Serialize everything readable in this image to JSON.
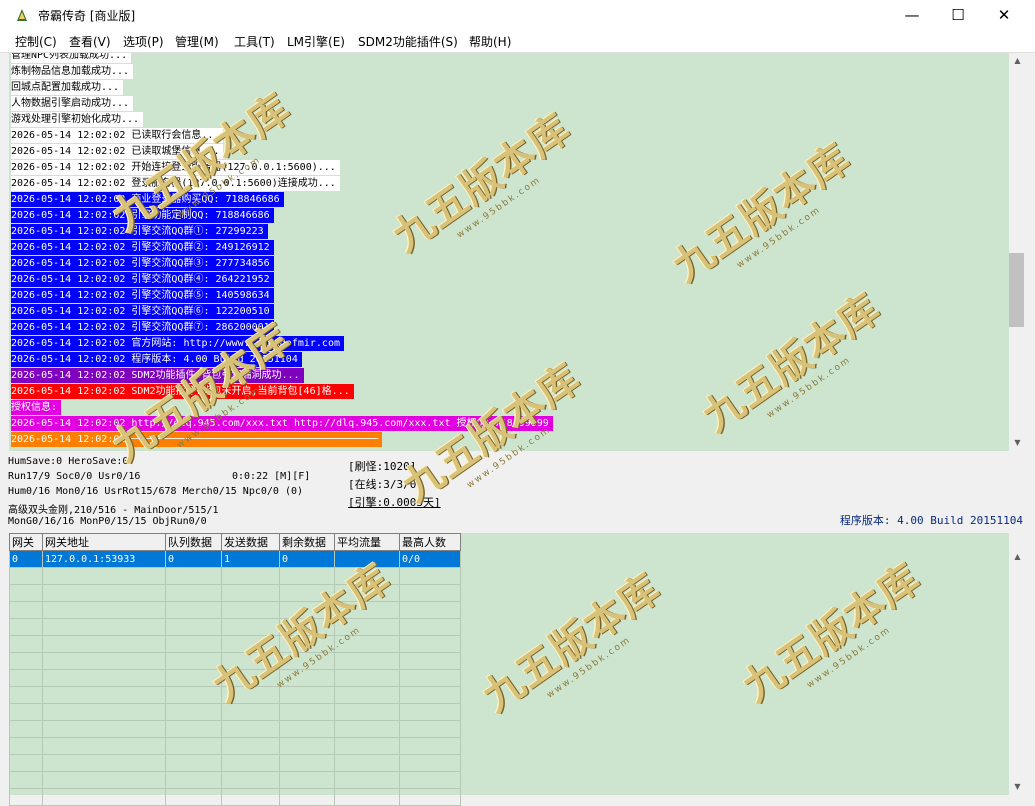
{
  "window": {
    "title": "帝霸传奇 [商业版]",
    "minimize": "—",
    "maximize": "☐",
    "close": "✕"
  },
  "menu": [
    "控制(C)",
    "查看(V)",
    "选项(P)",
    "管理(M)",
    "工具(T)",
    "LM引擎(E)",
    "SDM2功能插件(S)",
    "帮助(H)"
  ],
  "colors": {
    "log_bg": "#cde5cf",
    "blue": "#0000ff",
    "purple": "#8000c0",
    "red": "#ff0000",
    "magenta": "#e000e0",
    "orange": "#ff8000"
  },
  "log": [
    {
      "text": "管理NPC列表加载成功...",
      "bg": "#ffffff",
      "fg": "#000000"
    },
    {
      "text": "炼制物品信息加载成功...",
      "bg": "#ffffff",
      "fg": "#000000"
    },
    {
      "text": "回城点配置加载成功...",
      "bg": "#ffffff",
      "fg": "#000000"
    },
    {
      "text": "人物数据引擎启动成功...",
      "bg": "#ffffff",
      "fg": "#000000"
    },
    {
      "text": "游戏处理引擎初始化成功...",
      "bg": "#ffffff",
      "fg": "#000000"
    },
    {
      "text": "2026-05-14 12:02:02 已读取行会信息...",
      "bg": "#ffffff",
      "fg": "#000000"
    },
    {
      "text": "2026-05-14 12:02:02 已读取城堡信息...",
      "bg": "#ffffff",
      "fg": "#000000"
    },
    {
      "text": "2026-05-14 12:02:02 开始连接登录服务器(127.0.0.1:5600)...",
      "bg": "#ffffff",
      "fg": "#000000"
    },
    {
      "text": "2026-05-14 12:02:02 登录服务器(127.0.0.1:5600)连接成功...",
      "bg": "#ffffff",
      "fg": "#000000"
    },
    {
      "text": "2026-05-14 12:02:02 商业登录器购买QQ: 718846686",
      "bg": "#0000ff",
      "fg": "#ffffff"
    },
    {
      "text": "2026-05-14 12:02:02 引擎功能定制QQ: 718846686",
      "bg": "#0000ff",
      "fg": "#ffffff"
    },
    {
      "text": "2026-05-14 12:02:02 引擎交流QQ群①: 27299223",
      "bg": "#0000ff",
      "fg": "#ffffff"
    },
    {
      "text": "2026-05-14 12:02:02 引擎交流QQ群②: 249126912",
      "bg": "#0000ff",
      "fg": "#ffffff"
    },
    {
      "text": "2026-05-14 12:02:02 引擎交流QQ群③: 277734856",
      "bg": "#0000ff",
      "fg": "#ffffff"
    },
    {
      "text": "2026-05-14 12:02:02 引擎交流QQ群④: 264221952",
      "bg": "#0000ff",
      "fg": "#ffffff"
    },
    {
      "text": "2026-05-14 12:02:02 引擎交流QQ群⑤: 140598634",
      "bg": "#0000ff",
      "fg": "#ffffff"
    },
    {
      "text": "2026-05-14 12:02:02 引擎交流QQ群⑥: 122200510",
      "bg": "#0000ff",
      "fg": "#ffffff"
    },
    {
      "text": "2026-05-14 12:02:02 引擎交流QQ群⑦: 286200001",
      "bg": "#0000ff",
      "fg": "#ffffff"
    },
    {
      "text": "2026-05-14 12:02:02 官方网站: http://www.legendofmir.com",
      "bg": "#0000ff",
      "fg": "#ffffff"
    },
    {
      "text": "2026-05-14 12:02:02 程序版本: 4.00 Build 20151104",
      "bg": "#0000ff",
      "fg": "#ffffff"
    },
    {
      "text": "2026-05-14 12:02:02 SDM2功能插件:背包引擎漏洞成功...",
      "bg": "#8000c0",
      "fg": "#ffffff"
    },
    {
      "text": "2026-05-14 12:02:02 SDM2功能插件:背包未开启,当前背包[46]格...",
      "bg": "#ff0000",
      "fg": "#ffffff"
    },
    {
      "text": "授权信息:",
      "bg": "#e000e0",
      "fg": "#ffffff"
    },
    {
      "text": "2026-05-14 12:02:02 http://dlq.945.com/xxx.txt http://dlq.945.com/xxx.txt 授权QQ:718499999",
      "bg": "#e000e0",
      "fg": "#ffffff"
    },
    {
      "text": "2026-05-14 12:02:02 ─────────────────────────────────────────",
      "bg": "#ff8000",
      "fg": "#ffffff"
    }
  ],
  "status": {
    "line1": "HumSave:0 HeroSave:0",
    "line2": "Run17/9 Soc0/0 Usr0/16",
    "time": "0:0:22 [M][F]",
    "line3": "Hum0/16 Mon0/16 UsrRot15/678 Merch0/15 Npc0/0 (0)",
    "line4": "高级双头金刚,210/516 - MainDoor/515/1",
    "line5": "MonG0/16/16 MonP0/15/15 ObjRun0/0",
    "refresh": "[刷怪:1020]",
    "online": "[在线:3/3/0]",
    "engine": "[引擎:0.0003天]",
    "version": "程序版本: 4.00 Build 20151104"
  },
  "table": {
    "headers": [
      "网关",
      "网关地址",
      "队列数据",
      "发送数据",
      "剩余数据",
      "平均流量",
      "最高人数"
    ],
    "rows": [
      [
        "0",
        "127.0.0.1:53933",
        "0",
        "1",
        "0",
        "",
        "0/0"
      ]
    ]
  },
  "watermark": {
    "text": "九五版本库",
    "url": "www.95bbk.com"
  }
}
